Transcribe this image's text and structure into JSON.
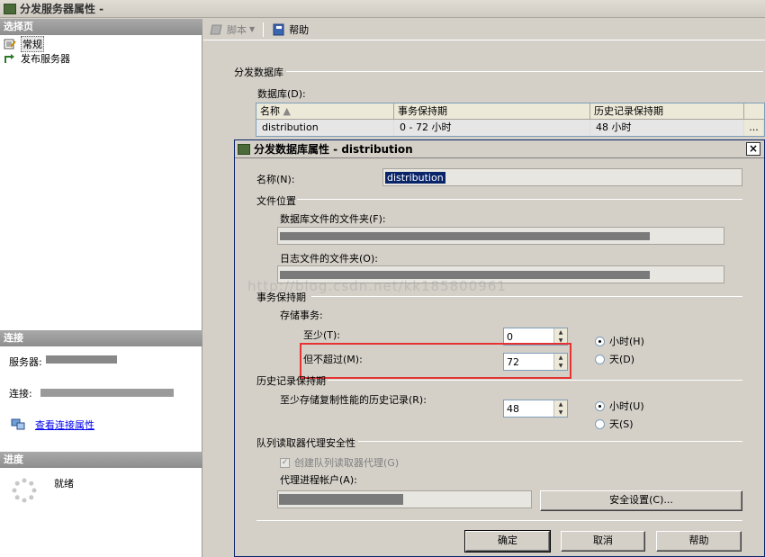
{
  "window": {
    "title": "分发服务器属性 -"
  },
  "left": {
    "select_page_header": "选择页",
    "pages": [
      {
        "label": "常规"
      },
      {
        "label": "发布服务器"
      }
    ],
    "connection_header": "连接",
    "server_label": "服务器:",
    "connection_label": "连接:",
    "connection_value_text": "",
    "view_connection_link": "查看连接属性",
    "progress_header": "进度",
    "status_text": "就绪"
  },
  "toolbar": {
    "script_label": "脚本",
    "help_label": "帮助"
  },
  "distrib_db": {
    "section_label": "分发数据库",
    "databases_label": "数据库(D):",
    "columns": [
      "名称",
      "事务保持期",
      "历史记录保持期"
    ],
    "rows": [
      {
        "name": "distribution",
        "txn": "0 - 72 小时",
        "history": "48 小时"
      }
    ]
  },
  "dialog": {
    "title": "分发数据库属性 - distribution",
    "close_glyph": "×",
    "name_label": "名称(N):",
    "name_value": "distribution",
    "file_location_label": "文件位置",
    "db_folder_label": "数据库文件的文件夹(F):",
    "log_folder_label": "日志文件的文件夹(O):",
    "db_folder_fill": 0.83,
    "log_folder_fill": 0.83,
    "txn_retention_label": "事务保持期",
    "store_txn_label": "存储事务:",
    "at_least_label": "至少(T):",
    "at_least_value": "0",
    "not_more_than_label": "但不超过(M):",
    "not_more_than_value": "72",
    "txn_hours_label": "小时(H)",
    "txn_days_label": "天(D)",
    "history_label": "历史记录保持期",
    "history_store_label": "至少存储复制性能的历史记录(R):",
    "history_value": "48",
    "history_hours_label": "小时(U)",
    "history_days_label": "天(S)",
    "queue_security_label": "队列读取器代理安全性",
    "create_queue_agent_label": "创建队列读取器代理(G)",
    "agent_account_label": "代理进程帐户(A):",
    "agent_account_fill": 0.49,
    "security_settings_label": "安全设置(C)...",
    "ok_label": "确定",
    "cancel_label": "取消",
    "help_label": "帮助"
  },
  "watermark_text": "http://blog.csdn.net/kk185800961",
  "colors": {
    "highlight": "#e53333",
    "title_bar": "#0a246a",
    "link": "#0000ee"
  }
}
